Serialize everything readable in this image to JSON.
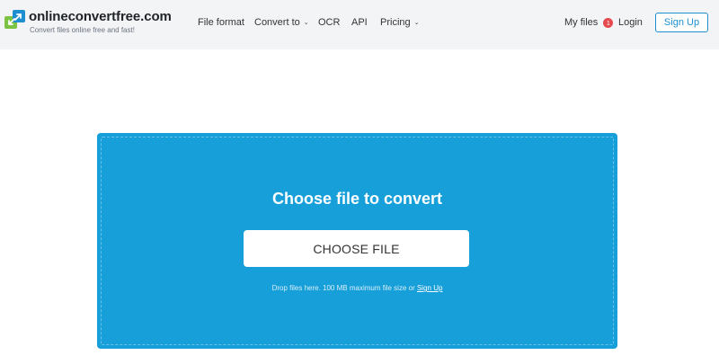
{
  "brand": {
    "name": "onlineconvertfree.com",
    "tagline": "Convert files online free and fast!",
    "colors": {
      "green": "#7cc243",
      "blue": "#1d8fd1"
    }
  },
  "nav": {
    "file_format": "File format",
    "convert_to": "Convert to",
    "ocr": "OCR",
    "api": "API",
    "pricing": "Pricing",
    "my_files": "My files",
    "my_files_badge": "1",
    "login": "Login",
    "signup": "Sign Up"
  },
  "upload": {
    "title": "Choose file to convert",
    "button": "CHOOSE FILE",
    "drop_text": "Drop files here. 100 MB maximum file size or",
    "signup_link": "Sign Up",
    "panel_color": "#179fd9"
  }
}
